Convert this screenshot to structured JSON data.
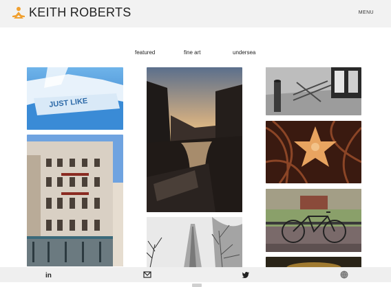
{
  "header": {
    "brand": "KEITH ROBERTS",
    "menu_label": "MENU",
    "logo_icon": "meditating-figure-icon",
    "accent_color": "#f0a030"
  },
  "filters": [
    {
      "label": "featured"
    },
    {
      "label": "fine art"
    },
    {
      "label": "undersea"
    }
  ],
  "gallery": [
    {
      "subject": "just-like-boat-hull"
    },
    {
      "subject": "venice-building"
    },
    {
      "subject": "venice-canal-sunset"
    },
    {
      "subject": "foggy-tower"
    },
    {
      "subject": "bollard-and-bench"
    },
    {
      "subject": "starfish"
    },
    {
      "subject": "bicycle-on-bridge"
    },
    {
      "subject": "partial-photo"
    }
  ],
  "boat_text": "JUST LIKE",
  "footer": {
    "icons": [
      "linkedin-icon",
      "mail-icon",
      "twitter-icon",
      "globe-icon"
    ],
    "linkedin_glyph": "in"
  }
}
